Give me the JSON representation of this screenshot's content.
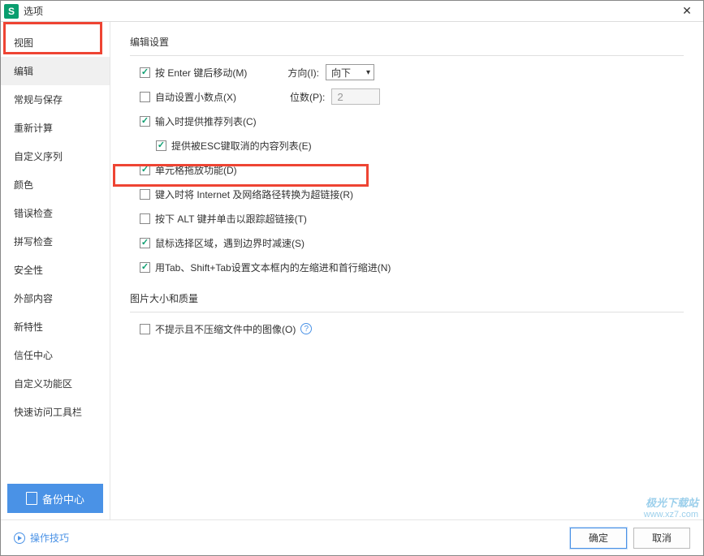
{
  "window": {
    "title": "选项",
    "app_icon": "S"
  },
  "sidebar": {
    "items": [
      {
        "label": "视图"
      },
      {
        "label": "编辑"
      },
      {
        "label": "常规与保存"
      },
      {
        "label": "重新计算"
      },
      {
        "label": "自定义序列"
      },
      {
        "label": "颜色"
      },
      {
        "label": "错误检查"
      },
      {
        "label": "拼写检查"
      },
      {
        "label": "安全性"
      },
      {
        "label": "外部内容"
      },
      {
        "label": "新特性"
      },
      {
        "label": "信任中心"
      },
      {
        "label": "自定义功能区"
      },
      {
        "label": "快速访问工具栏"
      }
    ],
    "backup_label": "备份中心"
  },
  "content": {
    "edit_section_title": "编辑设置",
    "image_section_title": "图片大小和质量",
    "options": {
      "enter_move": "按 Enter 键后移动(M)",
      "direction_label": "方向(I):",
      "direction_value": "向下",
      "auto_decimal": "自动设置小数点(X)",
      "places_label": "位数(P):",
      "places_value": "2",
      "input_recommend": "输入时提供推荐列表(C)",
      "esc_cancel_list": "提供被ESC键取消的内容列表(E)",
      "cell_drag": "单元格拖放功能(D)",
      "internet_hyperlink": "键入时将 Internet 及网络路径转换为超链接(R)",
      "alt_click_link": "按下 ALT 键并单击以跟踪超链接(T)",
      "mouse_select_slow": "鼠标选择区域，遇到边界时减速(S)",
      "tab_indent": "用Tab、Shift+Tab设置文本框内的左缩进和首行缩进(N)",
      "no_compress_image": "不提示且不压缩文件中的图像(O)"
    }
  },
  "footer": {
    "tips_label": "操作技巧",
    "ok_label": "确定",
    "cancel_label": "取消"
  },
  "watermark": {
    "brand": "极光下载站",
    "url": "www.xz7.com"
  }
}
